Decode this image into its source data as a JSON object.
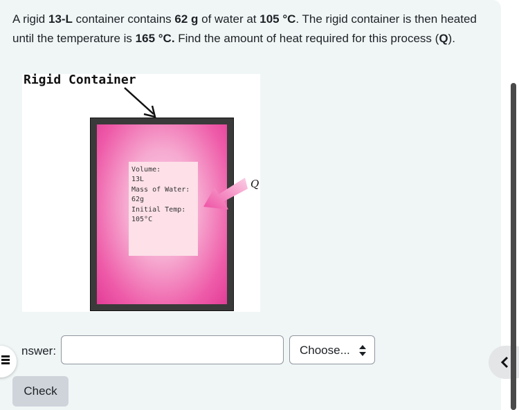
{
  "question": {
    "segments": [
      {
        "text": "A rigid ",
        "bold": false
      },
      {
        "text": "13-L",
        "bold": true
      },
      {
        "text": " container contains ",
        "bold": false
      },
      {
        "text": "62 g",
        "bold": true
      },
      {
        "text": " of water at ",
        "bold": false
      },
      {
        "text": "105 °C",
        "bold": true
      },
      {
        "text": ". The rigid container is then heated until the temperature is ",
        "bold": false
      },
      {
        "text": "165 °C.",
        "bold": true
      },
      {
        "text": " Find the amount of heat required for this process (",
        "bold": false
      },
      {
        "text": "Q",
        "bold": true
      },
      {
        "text": ").",
        "bold": false
      }
    ]
  },
  "figure": {
    "title": "Rigid Container",
    "info_lines": [
      "Volume:",
      "13L",
      "Mass of Water:",
      "62g",
      "Initial Temp:",
      "105°C"
    ],
    "heat_label": "Q",
    "colors": {
      "fill_edge": "#e23d97",
      "fill_center": "#fbd6ea",
      "arrow": "#f06cb2",
      "frame": "#3a3a3a"
    }
  },
  "answer": {
    "label": "nswer:",
    "value": "",
    "unit_select": {
      "selected": "Choose..."
    }
  },
  "check_button": {
    "label": "Check"
  },
  "icons": {
    "left_drawer": "hamburger-icon",
    "right_drawer": "chevron-left-icon",
    "select": "updown-arrows-icon"
  }
}
